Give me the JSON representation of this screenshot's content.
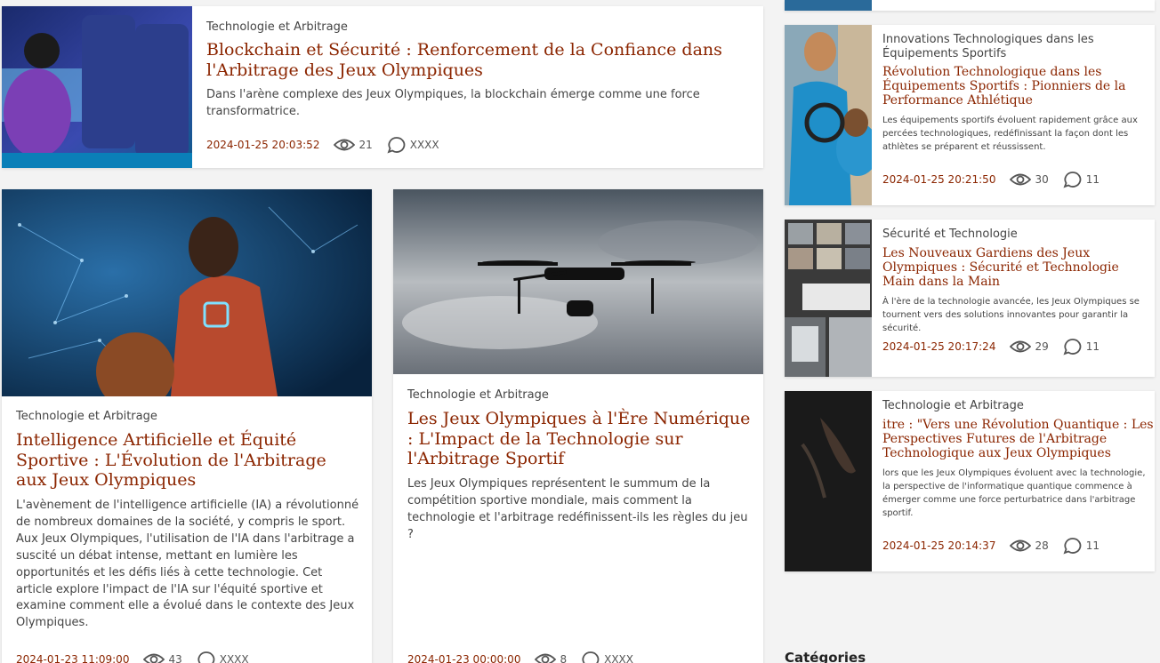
{
  "top_article": {
    "category": "Technologie et Arbitrage",
    "title": "Blockchain et Sécurité : Renforcement de la Confiance dans l'Arbitrage des Jeux Olympiques",
    "description": "Dans l'arène complexe des Jeux Olympiques, la blockchain émerge comme une force transformatrice.",
    "date": "2024-01-25 20:03:52",
    "views": "21",
    "comments": "XXXX",
    "image_icon": "esports-gamers-image"
  },
  "mid_articles": [
    {
      "category": "Technologie et Arbitrage",
      "title": "Intelligence Artificielle et Équité Sportive : L'Évolution de l'Arbitrage aux Jeux Olympiques",
      "description": "L'avènement de l'intelligence artificielle (IA) a révolutionné de nombreux domaines de la société, y compris le sport. Aux Jeux Olympiques, l'utilisation de l'IA dans l'arbitrage a suscité un débat intense, mettant en lumière les opportunités et les défis liés à cette technologie. Cet article explore l'impact de l'IA sur l'équité sportive et examine comment elle a évolué dans le contexte des Jeux Olympiques.",
      "date": "2024-01-23 11:09:00",
      "views": "43",
      "comments": "XXXX",
      "image_icon": "basketball-player-image"
    },
    {
      "category": "Technologie et Arbitrage",
      "title": "Les Jeux Olympiques à l'Ère Numérique : L'Impact de la Technologie sur l'Arbitrage Sportif",
      "description": "Les Jeux Olympiques représentent le summum de la compétition sportive mondiale, mais comment la technologie et l'arbitrage redéfinissent-ils les règles du jeu ?",
      "date": "2024-01-23 00:00:00",
      "views": "8",
      "comments": "XXXX",
      "image_icon": "drone-image"
    }
  ],
  "sidebar_articles": [
    {
      "category": "Innovations Technologiques dans les Équipements Sportifs",
      "title": "Révolution Technologique dans les Équipements Sportifs : Pionniers de la Performance Athlétique",
      "description": "Les équipements sportifs évoluent rapidement grâce aux percées technologiques, redéfinissant la façon dont les athlètes se préparent et réussissent.",
      "date": "2024-01-25 20:21:50",
      "views": "30",
      "comments": "11",
      "image_icon": "athletes-image"
    },
    {
      "category": "Sécurité et Technologie",
      "title": "Les Nouveaux Gardiens des Jeux Olympiques : Sécurité et Technologie Main dans la Main",
      "description": "À l'ère de la technologie avancée, les Jeux Olympiques se tournent vers des solutions innovantes pour garantir la sécurité.",
      "date": "2024-01-25 20:17:24",
      "views": "29",
      "comments": "11",
      "image_icon": "surveillance-screens-image"
    },
    {
      "category": "Technologie et Arbitrage",
      "title": "itre : \"Vers une Révolution Quantique : Les Perspectives Futures de l'Arbitrage Technologique aux Jeux Olympiques",
      "description": "lors que les Jeux Olympiques évoluent avec la technologie, la perspective de l'informatique quantique commence à émerger comme une force perturbatrice dans l'arbitrage sportif.",
      "date": "2024-01-25 20:14:37",
      "views": "28",
      "comments": "11",
      "image_icon": "dark-hand-image"
    }
  ],
  "sidebar": {
    "categories_heading": "Catégories"
  },
  "colors": {
    "title": "#8b2500",
    "date": "#8b2500",
    "background": "#f3f3f3"
  }
}
